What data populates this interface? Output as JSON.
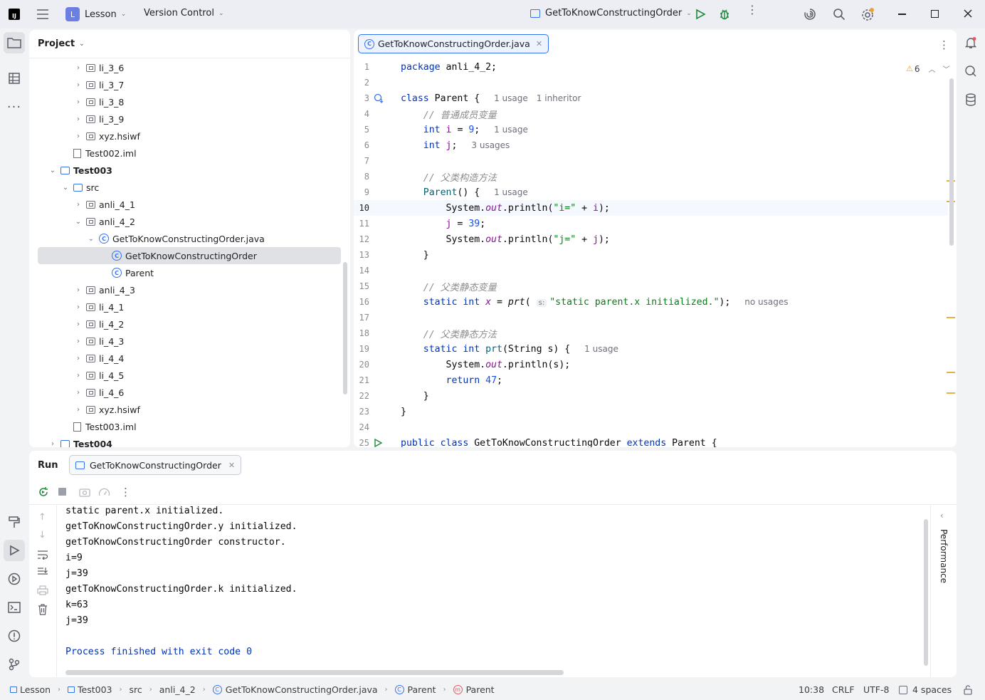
{
  "titlebar": {
    "project_name": "Lesson",
    "project_badge": "L",
    "vcs_label": "Version Control",
    "run_config": "GetToKnowConstructingOrder"
  },
  "project_panel": {
    "title": "Project",
    "tree": [
      {
        "label": "li_3_6",
        "kind": "package",
        "arrow": "›"
      },
      {
        "label": "li_3_7",
        "kind": "package",
        "arrow": "›"
      },
      {
        "label": "li_3_8",
        "kind": "package",
        "arrow": "›"
      },
      {
        "label": "li_3_9",
        "kind": "package",
        "arrow": "›"
      },
      {
        "label": "xyz.hsiwf",
        "kind": "package",
        "arrow": "›"
      },
      {
        "label": "Test002.iml",
        "kind": "file",
        "arrow": ""
      },
      {
        "label": "Test003",
        "kind": "module",
        "arrow": "⌄"
      },
      {
        "label": "src",
        "kind": "folder",
        "arrow": "⌄"
      },
      {
        "label": "anli_4_1",
        "kind": "package",
        "arrow": "›"
      },
      {
        "label": "anli_4_2",
        "kind": "package",
        "arrow": "⌄"
      },
      {
        "label": "GetToKnowConstructingOrder.java",
        "kind": "javafile",
        "arrow": "⌄"
      },
      {
        "label": "GetToKnowConstructingOrder",
        "kind": "class",
        "arrow": ""
      },
      {
        "label": "Parent",
        "kind": "class",
        "arrow": ""
      },
      {
        "label": "anli_4_3",
        "kind": "package",
        "arrow": "›"
      },
      {
        "label": "li_4_1",
        "kind": "package",
        "arrow": "›"
      },
      {
        "label": "li_4_2",
        "kind": "package",
        "arrow": "›"
      },
      {
        "label": "li_4_3",
        "kind": "package",
        "arrow": "›"
      },
      {
        "label": "li_4_4",
        "kind": "package",
        "arrow": "›"
      },
      {
        "label": "li_4_5",
        "kind": "package",
        "arrow": "›"
      },
      {
        "label": "li_4_6",
        "kind": "package",
        "arrow": "›"
      },
      {
        "label": "xyz.hsiwf",
        "kind": "package",
        "arrow": "›"
      },
      {
        "label": "Test003.iml",
        "kind": "file",
        "arrow": ""
      },
      {
        "label": "Test004",
        "kind": "module",
        "arrow": "›"
      }
    ]
  },
  "editor": {
    "tab_label": "GetToKnowConstructingOrder.java",
    "warning_count": "6",
    "line_numbers": [
      "1",
      "2",
      "3",
      "4",
      "5",
      "6",
      "7",
      "8",
      "9",
      "10",
      "11",
      "12",
      "13",
      "14",
      "15",
      "16",
      "17",
      "18",
      "19",
      "20",
      "21",
      "22",
      "23",
      "24",
      "25"
    ],
    "hints": {
      "l3_usage": "1 usage",
      "l3_inheritor": "1 inheritor",
      "l5": "1 usage",
      "l6": "3 usages",
      "l9": "1 usage",
      "l16": "no usages",
      "l16_param": "s:",
      "l19": "1 usage"
    },
    "comments": {
      "l4": "// 普通成员变量",
      "l8": "// 父类构造方法",
      "l15": "// 父类静态变量",
      "l18": "// 父类静态方法"
    }
  },
  "run_panel": {
    "title": "Run",
    "tab_label": "GetToKnowConstructingOrder",
    "side_label": "Performance",
    "output": [
      "static parent.x initialized.",
      "getToKnowConstructingOrder.y initialized.",
      "getToKnowConstructingOrder constructor.",
      "i=9",
      "j=39",
      "getToKnowConstructingOrder.k initialized.",
      "k=63",
      "j=39",
      "",
      "Process finished with exit code 0"
    ]
  },
  "statusbar": {
    "breadcrumbs": [
      "Lesson",
      "Test003",
      "src",
      "anli_4_2",
      "GetToKnowConstructingOrder.java",
      "Parent",
      "Parent"
    ],
    "position": "10:38",
    "line_sep": "CRLF",
    "encoding": "UTF-8",
    "indent": "4 spaces"
  }
}
